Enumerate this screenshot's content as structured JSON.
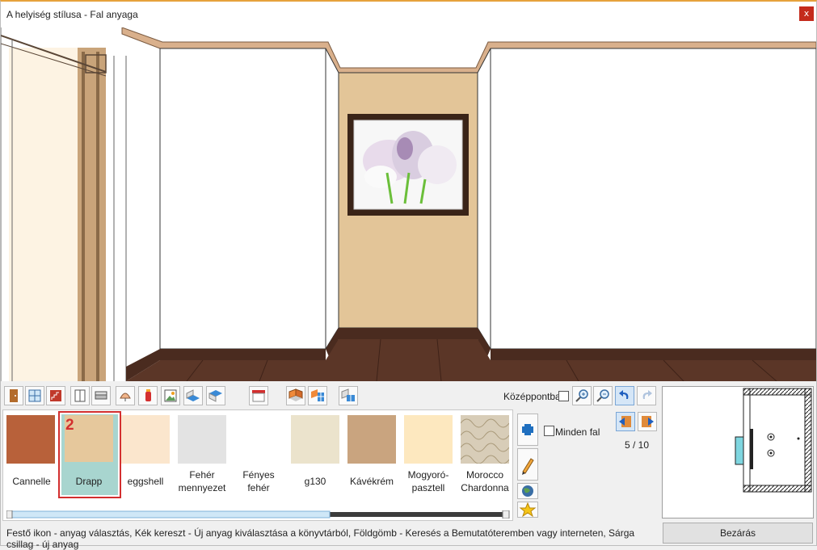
{
  "window": {
    "title": "A helyiség stílusa - Fal anyaga",
    "close_glyph": "x"
  },
  "toolbar": {
    "center_label": "Középpontba",
    "icons": [
      "door-icon",
      "window-icon",
      "stairs-icon",
      "wardrobe-icon",
      "sofa-icon",
      "lamp-icon",
      "fire-extinguisher-icon",
      "picture-icon",
      "floor-icon",
      "ceiling-icon",
      "curtain-icon",
      "wall-paint-icon",
      "wall-tile-icon",
      "floor-tile-icon",
      "zoom-in-icon",
      "zoom-out-icon",
      "undo-icon",
      "redo-icon"
    ]
  },
  "materials": {
    "items": [
      {
        "label": "Cannelle",
        "color": "#b8613a"
      },
      {
        "label": "Drapp",
        "color": "#e6c89c"
      },
      {
        "label": "eggshell",
        "color": "#fbe6cd"
      },
      {
        "label": "Fehér mennyezet",
        "color": "#e3e3e3"
      },
      {
        "label": "Fényes fehér",
        "color": "#ffffff"
      },
      {
        "label": "g130",
        "color": "#ebe3cc"
      },
      {
        "label": "Kávékrém",
        "color": "#c9a47f"
      },
      {
        "label": "Mogyoró-pasztell",
        "color": "#fde8bf"
      },
      {
        "label": "Morocco Chardonna",
        "color": "#d8cdb8"
      }
    ],
    "selected_index": 1,
    "selected_marker": "2"
  },
  "side": {
    "all_walls_label": "Minden fal"
  },
  "pager": {
    "text": "5 / 10"
  },
  "status": {
    "text": "Festő ikon - anyag választás, Kék kereszt - Új anyag kiválasztása a könyvtárból, Földgömb - Keresés a Bemutatóteremben vagy interneten, Sárga csillag - új anyag"
  },
  "buttons": {
    "close_label": "Bezárás"
  }
}
